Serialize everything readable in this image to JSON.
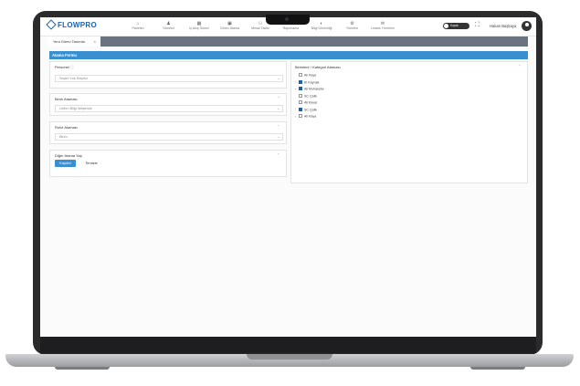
{
  "app": {
    "logo": "FLOWPRO"
  },
  "nav": {
    "items": [
      {
        "label": "Panelim",
        "icon": "home-icon",
        "glyph": "⌂"
      },
      {
        "label": "Yönetim",
        "icon": "user-icon",
        "glyph": "♟"
      },
      {
        "label": "İş Akış Süreci",
        "icon": "grid-icon",
        "glyph": "▦"
      },
      {
        "label": "Görev Atama",
        "icon": "tasks-icon",
        "glyph": "▣"
      },
      {
        "label": "Mesai Takibi",
        "icon": "people-icon",
        "glyph": "⚇"
      },
      {
        "label": "Raporlama",
        "icon": "chart-icon",
        "glyph": "●"
      },
      {
        "label": "Bilgi Güvenliği",
        "icon": "shield-icon",
        "glyph": "◐"
      },
      {
        "label": "Yönetim",
        "icon": "settings-icon",
        "glyph": "⚙"
      },
      {
        "label": "Lisans Yönetimi",
        "icon": "license-icon",
        "glyph": "✉"
      }
    ],
    "toggle_label": "Kapalı",
    "fullscreen_glyph": "⛶",
    "user_name": "Hakan Başkaya"
  },
  "tabs": [
    {
      "label": "Yeni Görev Tanımla",
      "close": "×"
    }
  ],
  "header": {
    "title": "Atama Formu"
  },
  "form": {
    "personnel": {
      "label": "Personel",
      "value": "Seçim Yok Seçiniz"
    },
    "unit": {
      "label": "Birim Ataması",
      "value": "Lütfen Bilgi İletişimde"
    },
    "role": {
      "label": "Rol/e Ataması",
      "value": "Birim"
    },
    "other": {
      "label": "Diğer Atama Yap"
    },
    "save_label": "Kaydet",
    "clear_label": "Temizle"
  },
  "tree": {
    "title": "Birimlere / Kategori Ataması",
    "items": [
      {
        "label": "Ali Kaya",
        "checked": false,
        "expandable": false
      },
      {
        "label": "İK Kaynak",
        "checked": true,
        "expandable": true
      },
      {
        "label": "Ali Muhasebe",
        "checked": true,
        "expandable": true
      },
      {
        "label": "SC Çelik",
        "checked": false,
        "expandable": false
      },
      {
        "label": "Ali Kaval",
        "checked": false,
        "expandable": false
      },
      {
        "label": "SC Çelik",
        "checked": true,
        "expandable": true
      },
      {
        "label": "Ali Kaya",
        "checked": false,
        "expandable": true
      }
    ]
  }
}
